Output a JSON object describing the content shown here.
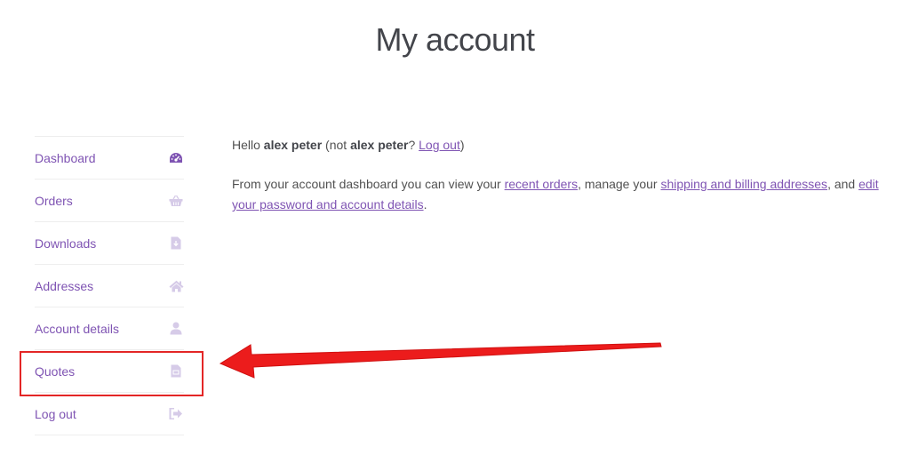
{
  "page": {
    "title": "My account"
  },
  "sidebar": {
    "items": [
      {
        "label": "Dashboard",
        "icon": "dashboard-icon",
        "active": true
      },
      {
        "label": "Orders",
        "icon": "basket-icon"
      },
      {
        "label": "Downloads",
        "icon": "file-download-icon"
      },
      {
        "label": "Addresses",
        "icon": "home-icon"
      },
      {
        "label": "Account details",
        "icon": "user-icon"
      },
      {
        "label": "Quotes",
        "icon": "file-icon"
      },
      {
        "label": "Log out",
        "icon": "sign-out-icon"
      }
    ]
  },
  "content": {
    "greeting_hello": "Hello ",
    "greeting_user": "alex peter",
    "greeting_not": " (not ",
    "greeting_user2": "alex peter",
    "greeting_q": "? ",
    "logout_link": "Log out",
    "greeting_close": ")",
    "intro_text": "From your account dashboard you can view your ",
    "recent_orders_link": "recent orders",
    "manage_text": ", manage your ",
    "addresses_link": "shipping and billing addresses",
    "and_text": ", and ",
    "edit_link": "edit your password and account details",
    "end_text": "."
  },
  "colors": {
    "accent": "#7f54b3",
    "icon_muted": "#d6cbe8",
    "icon_active": "#7f54b3",
    "annotation_red": "#e32626",
    "text": "#515151"
  }
}
